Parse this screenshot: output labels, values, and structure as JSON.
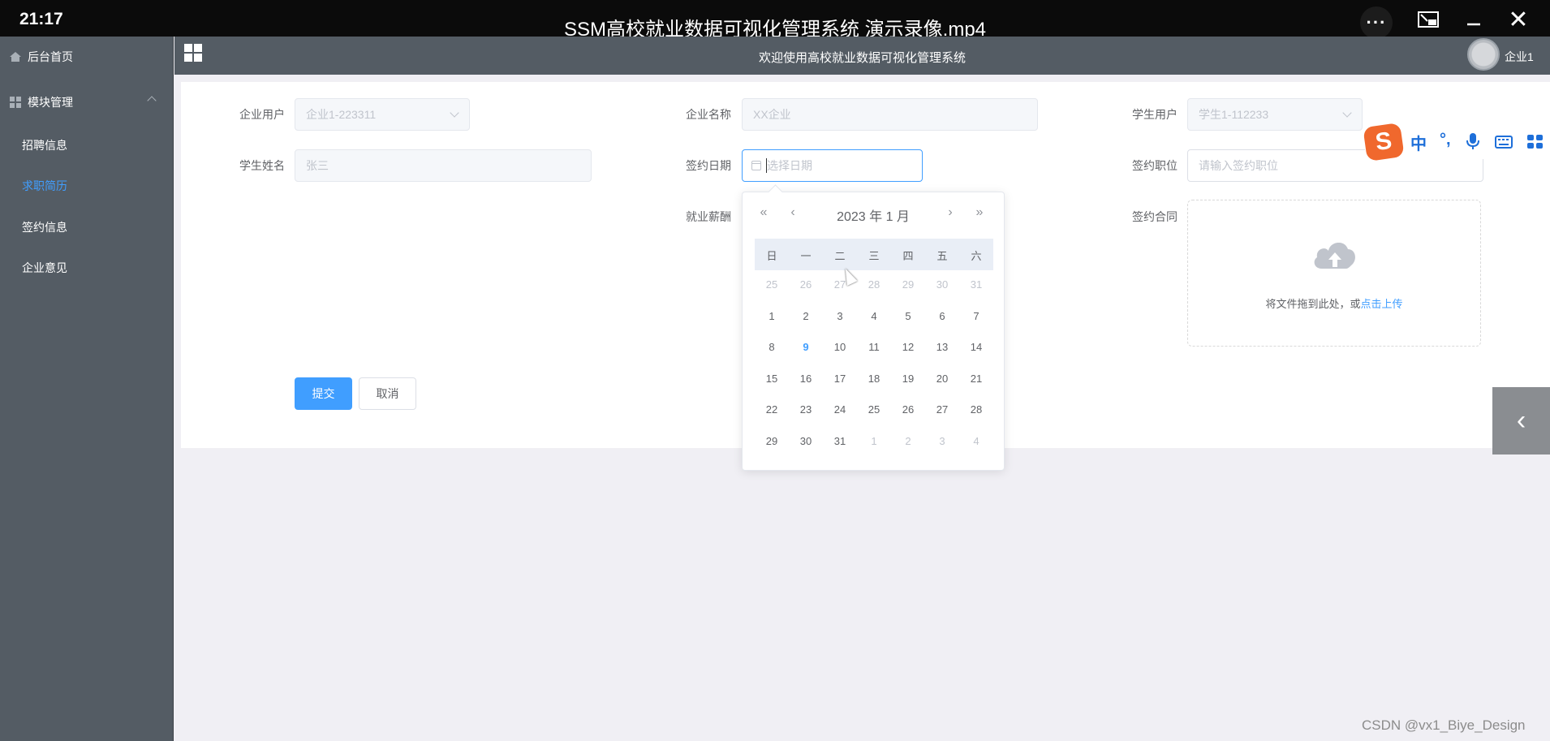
{
  "player": {
    "time": "21:17",
    "title": "SSM高校就业数据可视化管理系统 演示录像.mp4",
    "more_label": "···",
    "close_label": "✕"
  },
  "sidebar": {
    "home": "后台首页",
    "module": "模块管理",
    "items": [
      "招聘信息",
      "求职简历",
      "签约信息",
      "企业意见"
    ],
    "active_item": "求职简历"
  },
  "header": {
    "welcome": "欢迎使用高校就业数据可视化管理系统",
    "user": "企业1"
  },
  "form": {
    "company_user": {
      "label": "企业用户",
      "value": "企业1-223311"
    },
    "company_name": {
      "label": "企业名称",
      "value": "XX企业"
    },
    "student_user": {
      "label": "学生用户",
      "value": "学生1-112233"
    },
    "student_name": {
      "label": "学生姓名",
      "value": "张三"
    },
    "sign_date": {
      "label": "签约日期",
      "placeholder": "选择日期"
    },
    "sign_position": {
      "label": "签约职位",
      "placeholder": "请输入签约职位"
    },
    "salary": {
      "label": "就业薪酬"
    },
    "contract": {
      "label": "签约合同",
      "upload_text": "将文件拖到此处，或",
      "upload_link": "点击上传"
    },
    "submit": "提交",
    "cancel": "取消"
  },
  "datepicker": {
    "title": "2023 年  1 月",
    "prev_year": "«",
    "prev_month": "‹",
    "next_month": "›",
    "next_year": "»",
    "weekdays": [
      "日",
      "一",
      "二",
      "三",
      "四",
      "五",
      "六"
    ],
    "weeks": [
      [
        "25",
        "26",
        "27",
        "28",
        "29",
        "30",
        "31"
      ],
      [
        "1",
        "2",
        "3",
        "4",
        "5",
        "6",
        "7"
      ],
      [
        "8",
        "9",
        "10",
        "11",
        "12",
        "13",
        "14"
      ],
      [
        "15",
        "16",
        "17",
        "18",
        "19",
        "20",
        "21"
      ],
      [
        "22",
        "23",
        "24",
        "25",
        "26",
        "27",
        "28"
      ],
      [
        "29",
        "30",
        "31",
        "1",
        "2",
        "3",
        "4"
      ]
    ],
    "today": "9"
  },
  "ime": {
    "lang": "中",
    "punct": "°,",
    "logo": "S"
  },
  "side_tab": "‹",
  "watermark": "CSDN @vx1_Biye_Design"
}
